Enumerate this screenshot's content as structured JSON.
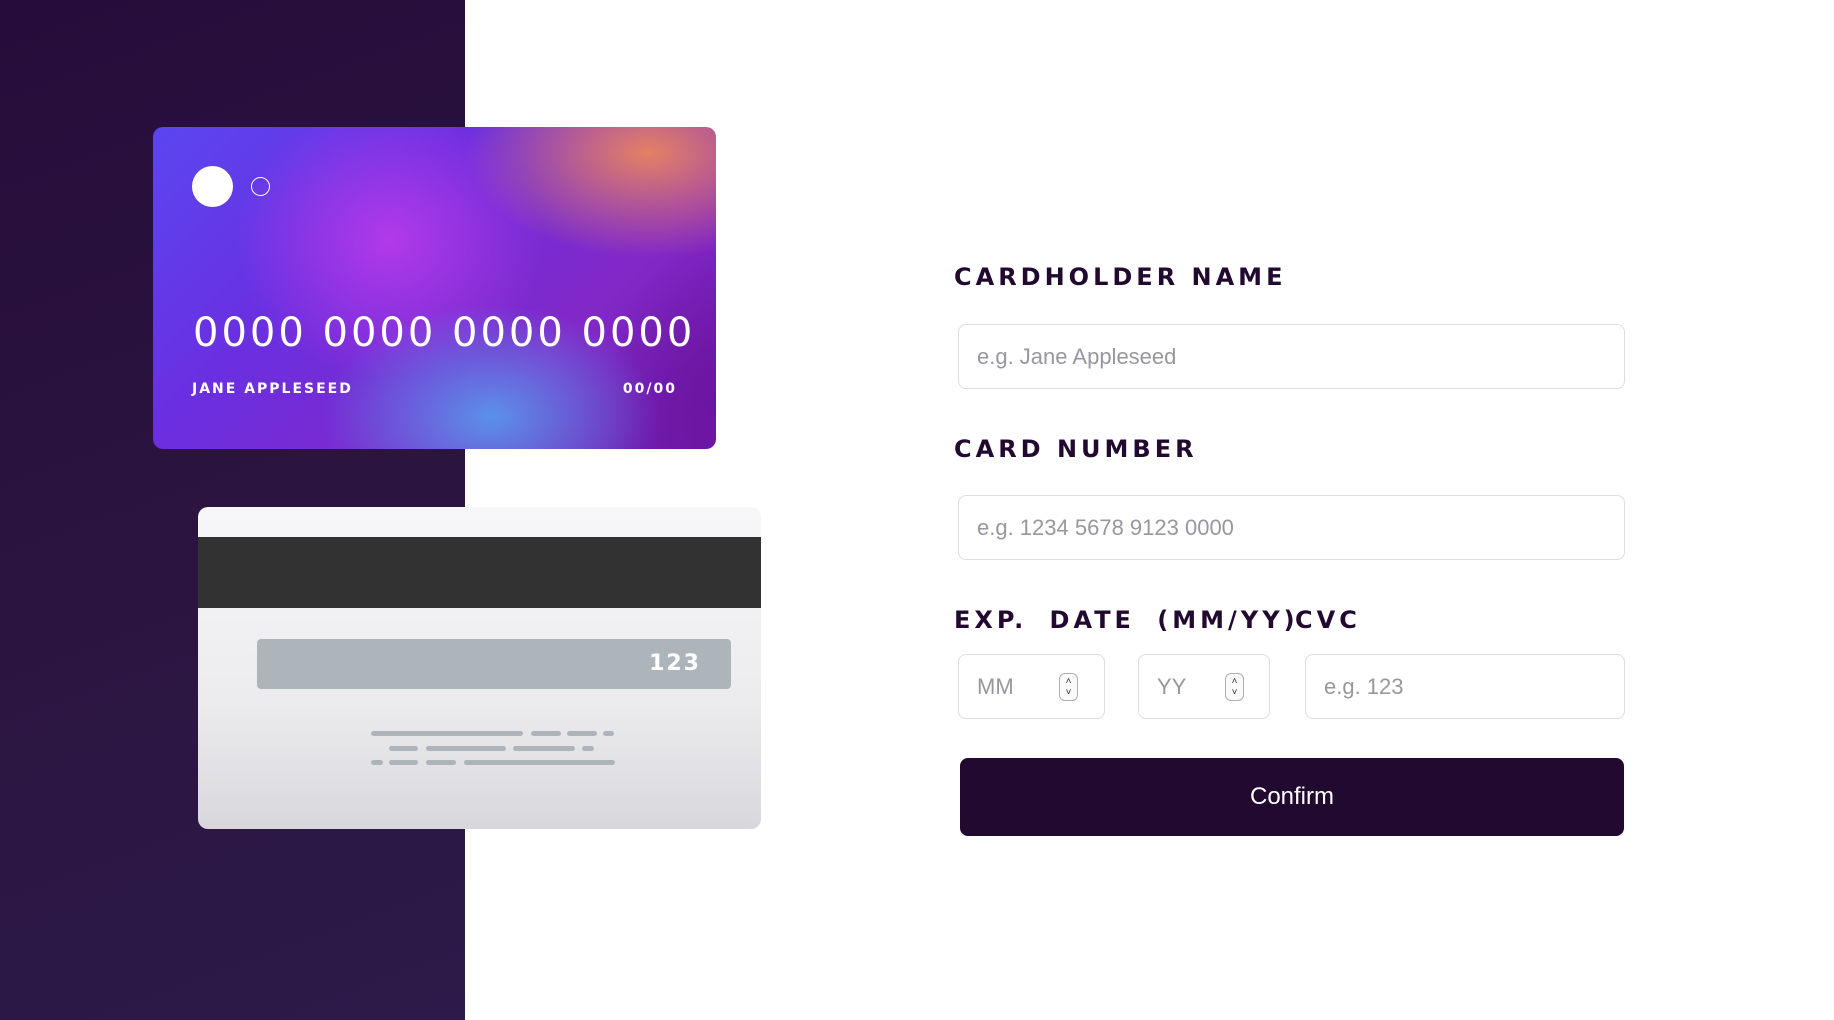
{
  "card_front": {
    "number": "0000 0000 0000 0000",
    "name": "JANE APPLESEED",
    "expiry": "00/00"
  },
  "card_back": {
    "cvc": "123"
  },
  "form": {
    "cardholder_label": "CARDHOLDER NAME",
    "cardholder_placeholder": "e.g. Jane Appleseed",
    "number_label": "CARD NUMBER",
    "number_placeholder": "e.g. 1234 5678 9123 0000",
    "exp_label": "EXP. DATE (MM/YY)",
    "month_placeholder": "MM",
    "year_placeholder": "YY",
    "cvc_label": "CVC",
    "cvc_placeholder": "e.g. 123",
    "confirm_label": "Confirm"
  },
  "colors": {
    "panel": "#260c3a",
    "button": "#21092f",
    "input_border": "#dedddf",
    "placeholder": "#9a96a0"
  }
}
